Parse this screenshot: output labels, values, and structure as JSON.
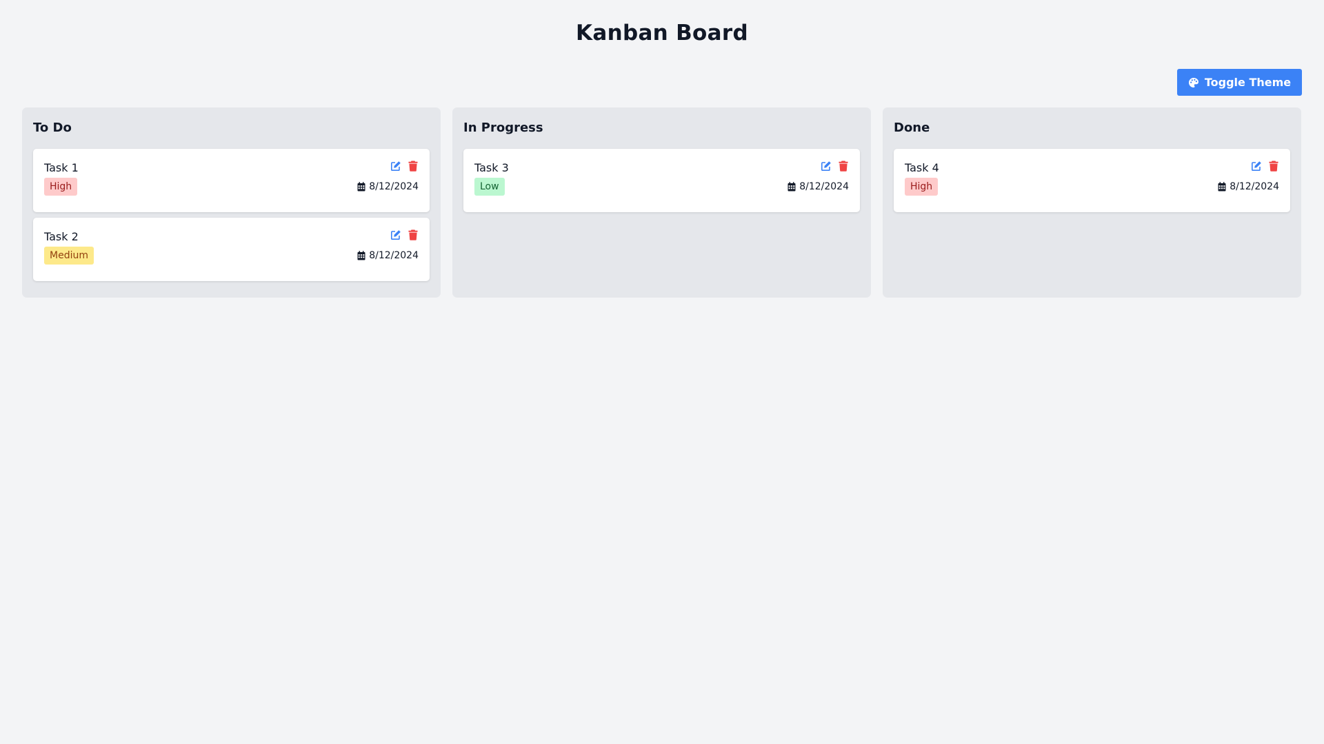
{
  "header": {
    "title": "Kanban Board",
    "toggle_label": "Toggle Theme",
    "toggle_icon": "palette-icon"
  },
  "colors": {
    "background": "#f3f4f6",
    "column_bg": "#e5e7eb",
    "accent": "#3b82f6",
    "delete": "#ef4444",
    "high_bg": "#fecaca",
    "medium_bg": "#fde98a",
    "low_bg": "#bbf7d0"
  },
  "columns": [
    {
      "title": "To Do",
      "cards": [
        {
          "title": "Task 1",
          "priority": "High",
          "date": "8/12/2024"
        },
        {
          "title": "Task 2",
          "priority": "Medium",
          "date": "8/12/2024"
        }
      ]
    },
    {
      "title": "In Progress",
      "cards": [
        {
          "title": "Task 3",
          "priority": "Low",
          "date": "8/12/2024"
        }
      ]
    },
    {
      "title": "Done",
      "cards": [
        {
          "title": "Task 4",
          "priority": "High",
          "date": "8/12/2024"
        }
      ]
    }
  ],
  "icons": {
    "edit": "edit-icon",
    "delete": "trash-icon",
    "date": "calendar-icon"
  }
}
